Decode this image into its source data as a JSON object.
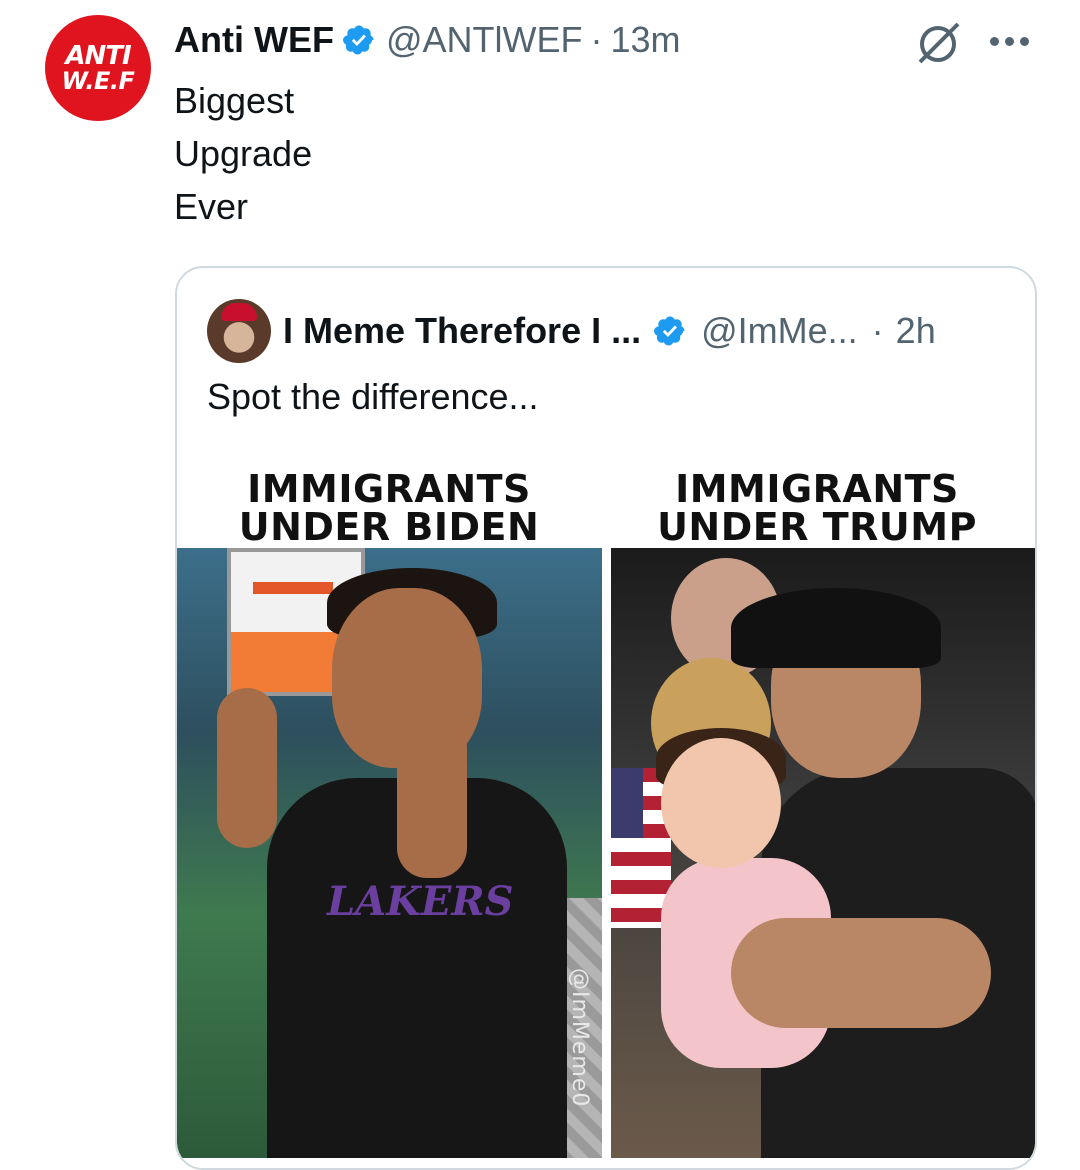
{
  "tweet": {
    "avatar_text_line1": "ANTI",
    "avatar_text_line2": "W.E.F",
    "author_name": "Anti WEF",
    "handle": "@ANTlWEF",
    "separator": "·",
    "time": "13m",
    "text": "Biggest\nUpgrade\nEver"
  },
  "quoted": {
    "author_name": "I Meme Therefore I ...",
    "handle": "@ImMe...",
    "separator": "·",
    "time": "2h",
    "text": "Spot the difference...",
    "image": {
      "caption_left_line1": "IMMIGRANTS",
      "caption_left_line2": "UNDER BIDEN",
      "caption_right_line1": "IMMIGRANTS",
      "caption_right_line2": "UNDER TRUMP",
      "watermark": "@ImMeme0",
      "shirt_text": "LAKERS"
    }
  },
  "colors": {
    "verified": "#1d9bf0",
    "muted": "#536471",
    "avatar_bg": "#e0141e",
    "card_border": "#cfd9de"
  },
  "icons": [
    "verified-badge-icon",
    "grok-icon",
    "more-options-icon"
  ]
}
